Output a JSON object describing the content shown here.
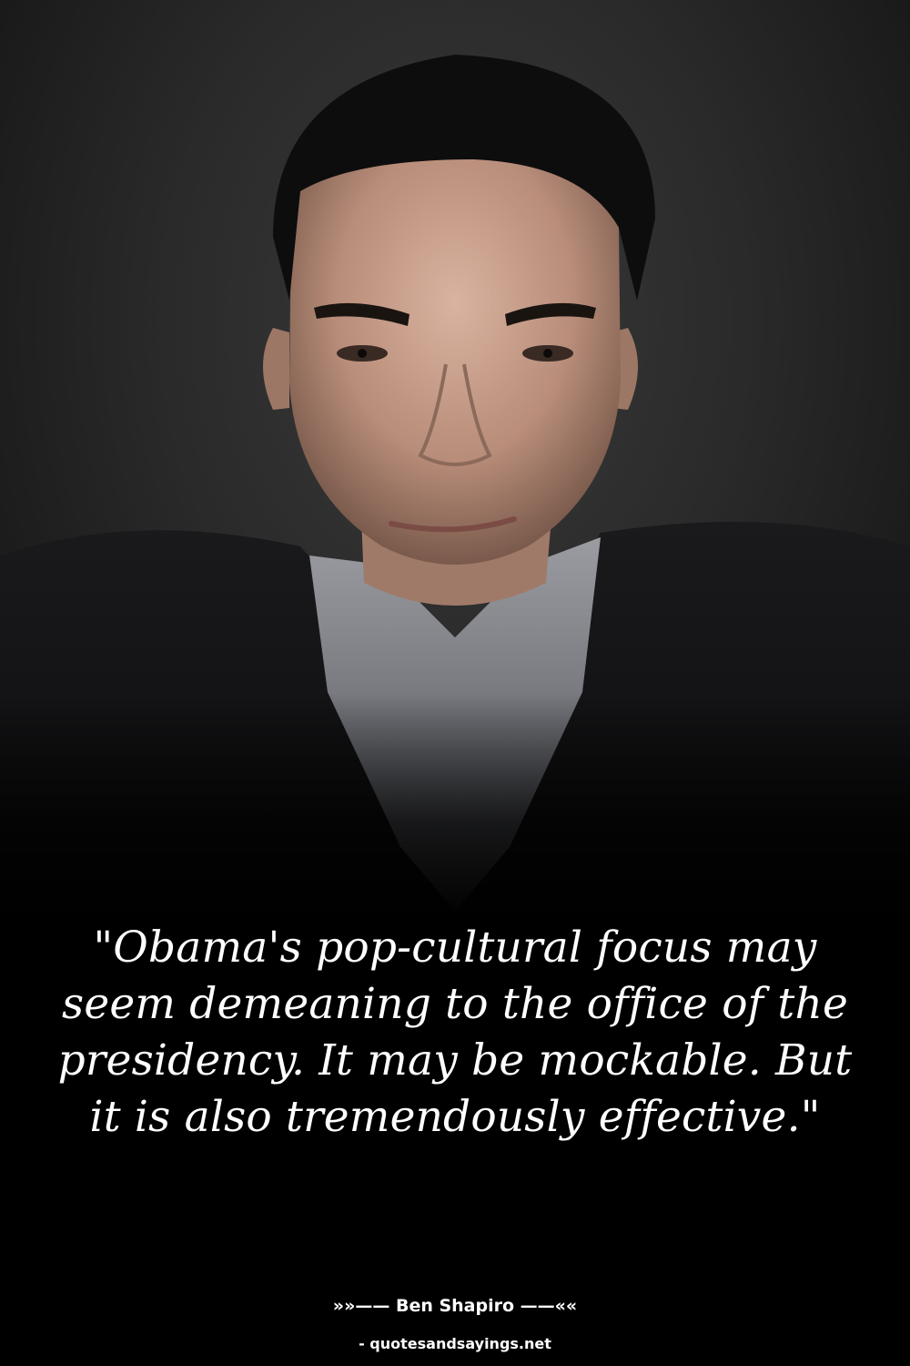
{
  "quote": {
    "text": "\"Obama's pop-cultural focus may seem demeaning to the office of the presidency. It may be mockable. But it is also tremendously effective.\""
  },
  "attribution": {
    "text": "»»—— Ben Shapiro ——««"
  },
  "source": {
    "text": "- quotesandsayings.net"
  },
  "colors": {
    "background": "#000000",
    "text": "#ffffff"
  }
}
